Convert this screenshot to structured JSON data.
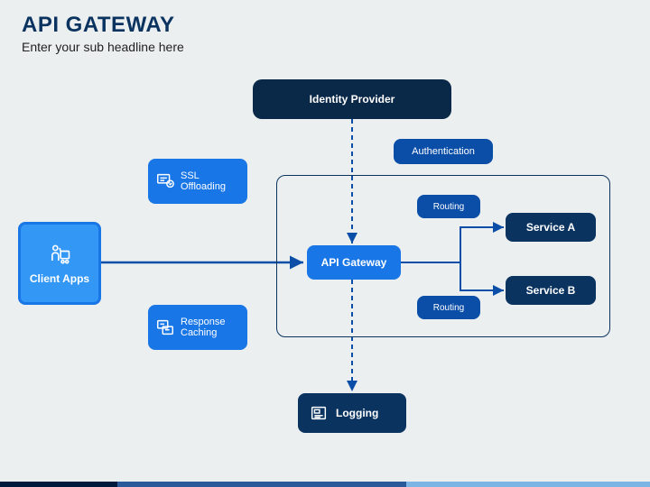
{
  "header": {
    "title": "API GATEWAY",
    "subtitle": "Enter your sub headline here"
  },
  "nodes": {
    "identity": "Identity Provider",
    "auth": "Authentication",
    "ssl": "SSL Offloading",
    "cache": "Response Caching",
    "client": "Client Apps",
    "gateway": "API Gateway",
    "routing1": "Routing",
    "routing2": "Routing",
    "serviceA": "Service A",
    "serviceB": "Service B",
    "logging": "Logging"
  }
}
